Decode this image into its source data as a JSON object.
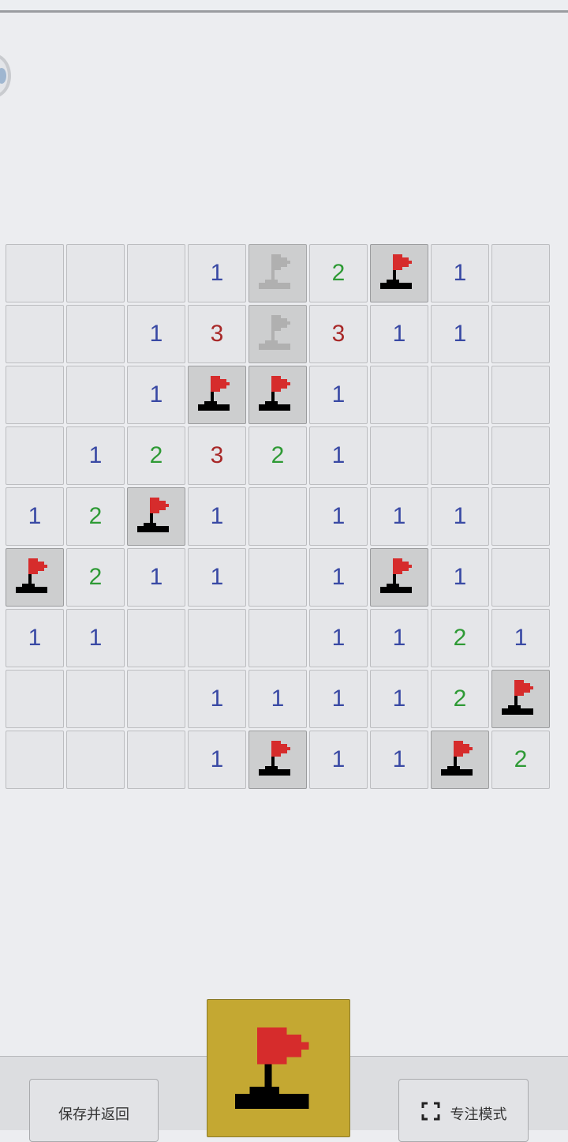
{
  "board": {
    "rows": 9,
    "cols": 9,
    "cells": [
      [
        "",
        "",
        "",
        "1",
        "H",
        "2",
        "F",
        "1",
        ""
      ],
      [
        "",
        "",
        "1",
        "3",
        "H",
        "3",
        "1",
        "1",
        ""
      ],
      [
        "",
        "",
        "1",
        "F",
        "F",
        "1",
        "",
        "",
        ""
      ],
      [
        "",
        "1",
        "2",
        "3",
        "2",
        "1",
        "",
        "",
        ""
      ],
      [
        "1",
        "2",
        "F",
        "1",
        "",
        "1",
        "1",
        "1",
        ""
      ],
      [
        "F",
        "2",
        "1",
        "1",
        "",
        "1",
        "F",
        "1",
        ""
      ],
      [
        "1",
        "1",
        "",
        "",
        "",
        "1",
        "1",
        "2",
        "1"
      ],
      [
        "",
        "",
        "",
        "1",
        "1",
        "1",
        "1",
        "2",
        "F"
      ],
      [
        "",
        "",
        "",
        "1",
        "F",
        "1",
        "1",
        "F",
        "2"
      ]
    ],
    "legend": {
      "F": "flag",
      "H": "flag-hint"
    }
  },
  "colors": {
    "n1": "#3949a4",
    "n2": "#2e9a35",
    "n3": "#a82828",
    "flag": "#d62c2c",
    "flag_hint": "#b0b0b0",
    "mode_button": "#c4a832"
  },
  "toolbar": {
    "save_label": "保存并返回",
    "focus_label": "专注模式",
    "mode_icon": "flag-icon",
    "focus_icon": "fullscreen-icon"
  }
}
